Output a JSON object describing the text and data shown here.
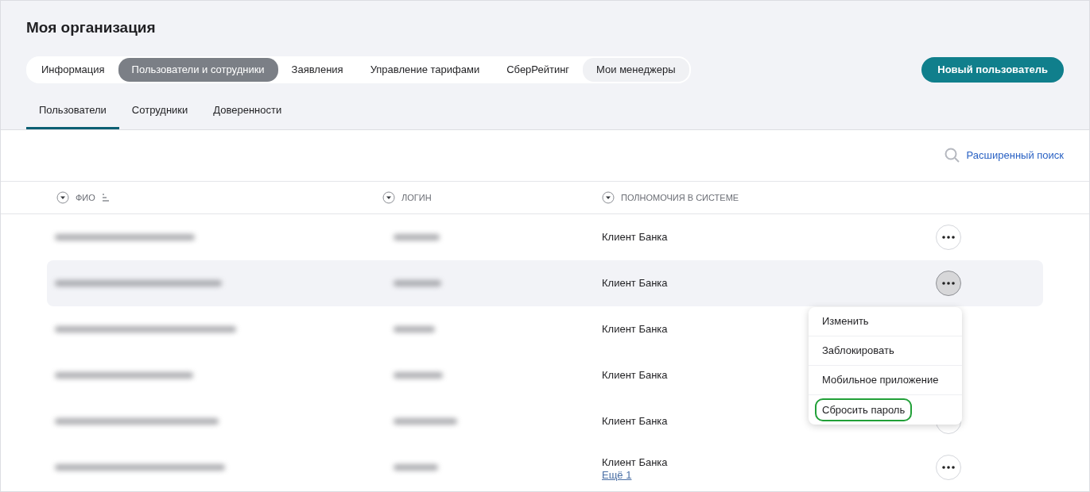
{
  "page_title": "Моя организация",
  "tabs": [
    {
      "label": "Информация",
      "selected": false,
      "hovered": false
    },
    {
      "label": "Пользователи и сотрудники",
      "selected": true,
      "hovered": false
    },
    {
      "label": "Заявления",
      "selected": false,
      "hovered": false
    },
    {
      "label": "Управление тарифами",
      "selected": false,
      "hovered": false
    },
    {
      "label": "СберРейтинг",
      "selected": false,
      "hovered": false
    },
    {
      "label": "Мои менеджеры",
      "selected": false,
      "hovered": true
    }
  ],
  "new_user_button": "Новый пользователь",
  "subtabs": [
    {
      "label": "Пользователи",
      "selected": true
    },
    {
      "label": "Сотрудники",
      "selected": false
    },
    {
      "label": "Доверенности",
      "selected": false
    }
  ],
  "advanced_search": "Расширенный поиск",
  "table": {
    "columns": [
      {
        "label": "ФИО",
        "sorted": true
      },
      {
        "label": "ЛОГИН",
        "sorted": false
      },
      {
        "label": "ПОЛНОМОЧИЯ В СИСТЕМЕ",
        "sorted": false
      }
    ],
    "rows": [
      {
        "authority": "Клиент Банка",
        "selected": false,
        "menu_open": false
      },
      {
        "authority": "Клиент Банка",
        "selected": true,
        "menu_open": true
      },
      {
        "authority": "Клиент Банка",
        "selected": false,
        "menu_open": false
      },
      {
        "authority": "Клиент Банка",
        "selected": false,
        "menu_open": false
      },
      {
        "authority": "Клиент Банка",
        "selected": false,
        "menu_open": false
      },
      {
        "authority": "Клиент Банка",
        "more": "Ещё 1",
        "selected": false,
        "menu_open": false
      }
    ]
  },
  "row_menu": [
    {
      "label": "Изменить",
      "focused": false
    },
    {
      "label": "Заблокировать",
      "focused": false
    },
    {
      "label": "Мобильное приложение",
      "focused": false
    },
    {
      "label": "Сбросить пароль",
      "focused": true
    }
  ]
}
